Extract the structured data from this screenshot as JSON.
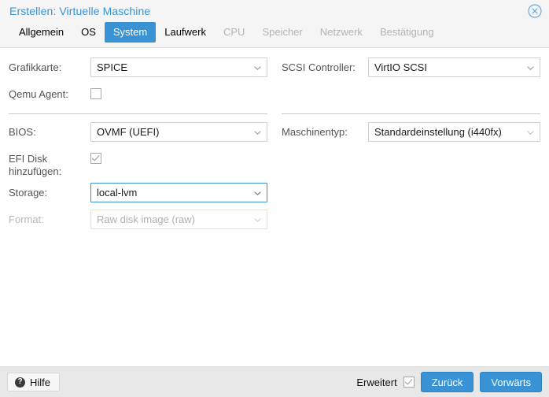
{
  "window": {
    "title": "Erstellen: Virtuelle Maschine",
    "close_icon": "close-circle-icon",
    "accent_color": "#3892d4",
    "title_color": "#3892d4"
  },
  "tabs": [
    {
      "label": "Allgemein",
      "state": "enabled"
    },
    {
      "label": "OS",
      "state": "enabled"
    },
    {
      "label": "System",
      "state": "active"
    },
    {
      "label": "Laufwerk",
      "state": "enabled"
    },
    {
      "label": "CPU",
      "state": "disabled"
    },
    {
      "label": "Speicher",
      "state": "disabled"
    },
    {
      "label": "Netzwerk",
      "state": "disabled"
    },
    {
      "label": "Bestätigung",
      "state": "disabled"
    }
  ],
  "form": {
    "graphics": {
      "label": "Grafikkarte:",
      "value": "SPICE",
      "type": "select",
      "state": "enabled"
    },
    "scsi_controller": {
      "label": "SCSI Controller:",
      "value": "VirtIO SCSI",
      "type": "select",
      "state": "enabled"
    },
    "qemu_agent": {
      "label": "Qemu Agent:",
      "checked": false,
      "type": "checkbox"
    },
    "bios": {
      "label": "BIOS:",
      "value": "OVMF (UEFI)",
      "type": "select",
      "state": "enabled"
    },
    "machine_type": {
      "label": "Maschinentyp:",
      "value": "Standardeinstellung (i440fx)",
      "type": "select",
      "state": "enabled"
    },
    "efi_disk": {
      "label": "EFI Disk hinzufügen:",
      "checked": true,
      "type": "checkbox"
    },
    "storage": {
      "label": "Storage:",
      "value": "local-lvm",
      "type": "select",
      "state": "focused"
    },
    "format": {
      "label": "Format:",
      "value": "Raw disk image (raw)",
      "type": "select",
      "state": "disabled"
    }
  },
  "footer": {
    "help_label": "Hilfe",
    "help_icon": "question-mark-icon",
    "advanced_label": "Erweitert",
    "advanced_checked": true,
    "back_label": "Zurück",
    "next_label": "Vorwärts"
  }
}
